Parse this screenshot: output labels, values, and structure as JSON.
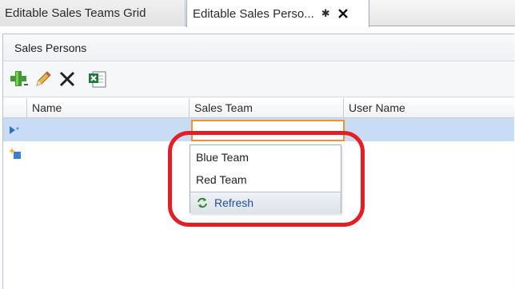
{
  "tabs": [
    {
      "label": "Editable Sales Teams Grid",
      "active": false
    },
    {
      "label": "Editable Sales Perso...",
      "active": true,
      "dirty_marker": "✱",
      "close_glyph": "✕"
    }
  ],
  "panel": {
    "title": "Sales Persons"
  },
  "toolbar": {
    "buttons": [
      {
        "name": "add-icon"
      },
      {
        "name": "pencil-icon"
      },
      {
        "name": "delete-icon"
      },
      {
        "name": "excel-export-icon"
      }
    ]
  },
  "grid": {
    "columns": [
      "Name",
      "Sales Team",
      "User Name"
    ],
    "rows": [
      {
        "indicator": "new-row-current-icon",
        "name": "",
        "sales_team": "",
        "user_name": ""
      },
      {
        "indicator": "new-row-icon",
        "name": "",
        "sales_team": "",
        "user_name": ""
      }
    ]
  },
  "dropdown": {
    "options": [
      "Blue Team",
      "Red Team"
    ],
    "refresh_label": "Refresh"
  },
  "colors": {
    "selection": "#c9dcf6",
    "editor_border": "#f0922f",
    "highlight": "#e31e24",
    "link": "#1f4f9e"
  }
}
